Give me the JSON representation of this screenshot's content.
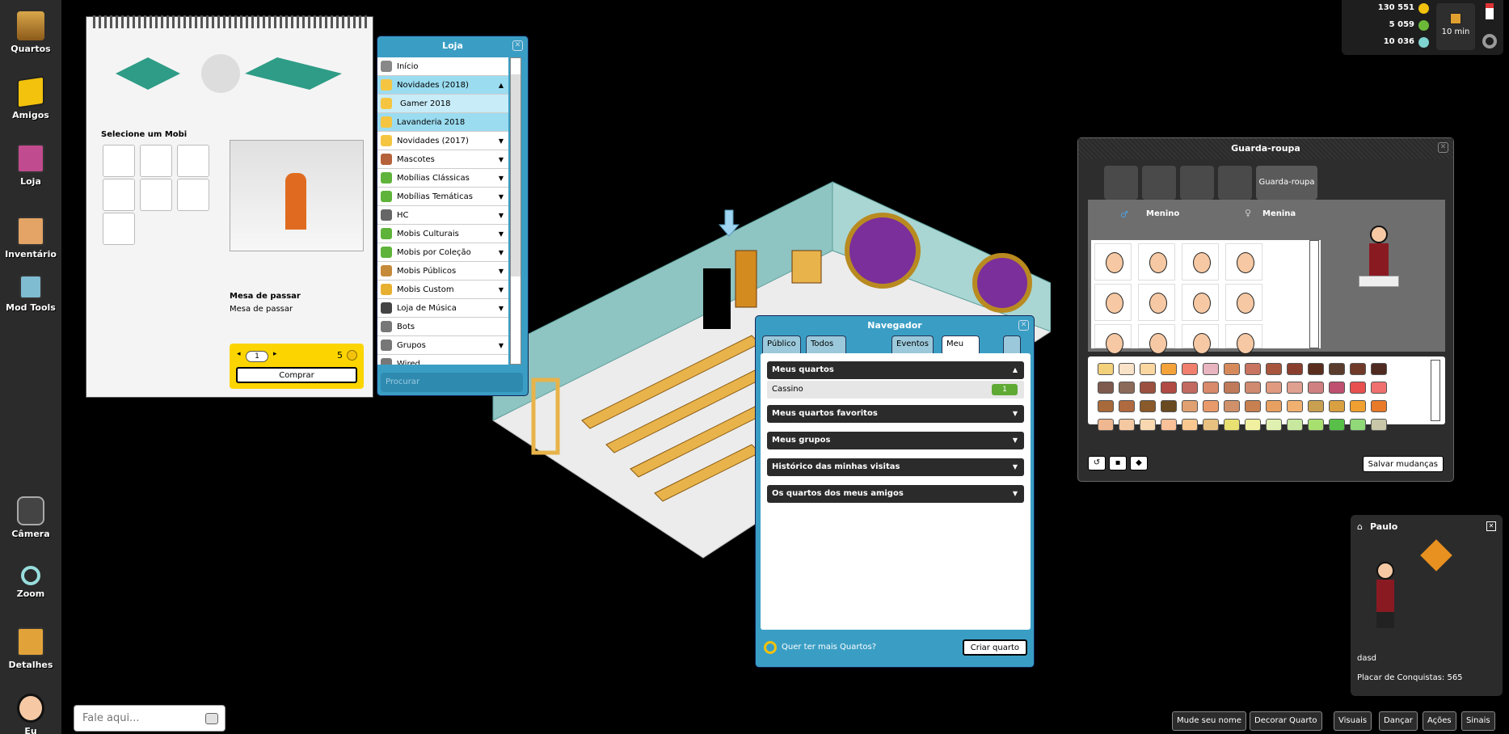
{
  "sidebar": {
    "items": [
      {
        "label": "Quartos",
        "icon": "hotel-icon"
      },
      {
        "label": "Amigos",
        "icon": "friends-icon"
      },
      {
        "label": "Loja",
        "icon": "catalog-icon"
      },
      {
        "label": "Inventário",
        "icon": "inventory-icon"
      },
      {
        "label": "Mod Tools",
        "icon": "mod-tools-icon"
      },
      {
        "label": "Câmera",
        "icon": "camera-icon"
      },
      {
        "label": "Zoom",
        "icon": "zoom-icon"
      },
      {
        "label": "Detalhes",
        "icon": "details-icon"
      },
      {
        "label": "Eu",
        "icon": "avatar-icon"
      }
    ]
  },
  "chat": {
    "placeholder": "Fale aqui..."
  },
  "currency": {
    "credits": "130 551",
    "duckets": "5 059",
    "diamonds": "10 036",
    "timer": "10 min",
    "colors": {
      "credits": "#f2c20c",
      "duckets": "#6cb93a",
      "diamonds": "#7fd3d0"
    }
  },
  "builder": {
    "select_label": "Selecione um Mobi",
    "mobi_name": "Mesa de passar",
    "mobi_desc": "Mesa de passar",
    "quantity": "1",
    "price": "5",
    "buy_label": "Comprar"
  },
  "loja": {
    "title": "Loja",
    "items": [
      {
        "label": "Início",
        "arrow": "",
        "state": "",
        "color": "#888"
      },
      {
        "label": "Novidades (2018)",
        "arrow": "▲",
        "state": "sel",
        "color": "#f5c542"
      },
      {
        "label": "Gamer 2018",
        "arrow": "",
        "state": "sub",
        "color": "#f5c542"
      },
      {
        "label": "Lavanderia 2018",
        "arrow": "",
        "state": "sel",
        "color": "#f5c542"
      },
      {
        "label": "Novidades (2017)",
        "arrow": "▼",
        "state": "",
        "color": "#f5c542"
      },
      {
        "label": "Mascotes",
        "arrow": "▼",
        "state": "",
        "color": "#b5623a"
      },
      {
        "label": "Mobílias Clássicas",
        "arrow": "▼",
        "state": "",
        "color": "#5fb33a"
      },
      {
        "label": "Mobílias Temáticas",
        "arrow": "▼",
        "state": "",
        "color": "#5fb33a"
      },
      {
        "label": "HC",
        "arrow": "▼",
        "state": "",
        "color": "#666"
      },
      {
        "label": "Mobis Culturais",
        "arrow": "▼",
        "state": "",
        "color": "#5fb33a"
      },
      {
        "label": "Mobis por Coleção",
        "arrow": "▼",
        "state": "",
        "color": "#5fb33a"
      },
      {
        "label": "Mobis Públicos",
        "arrow": "▼",
        "state": "",
        "color": "#c58a3a"
      },
      {
        "label": "Mobis Custom",
        "arrow": "▼",
        "state": "",
        "color": "#e8b030"
      },
      {
        "label": "Loja de Música",
        "arrow": "▼",
        "state": "",
        "color": "#444"
      },
      {
        "label": "Bots",
        "arrow": "",
        "state": "",
        "color": "#777"
      },
      {
        "label": "Grupos",
        "arrow": "▼",
        "state": "",
        "color": "#777"
      },
      {
        "label": "Wired",
        "arrow": "",
        "state": "",
        "color": "#777"
      }
    ],
    "search_placeholder": "Procurar"
  },
  "navigator": {
    "title": "Navegador",
    "tabs": [
      "Público",
      "Todos os quartos",
      "Eventos",
      "Meu mundo"
    ],
    "sections": [
      {
        "label": "Meus quartos",
        "chev": "▲"
      },
      {
        "label": "Meus quartos favoritos",
        "chev": "▼"
      },
      {
        "label": "Meus grupos",
        "chev": "▼"
      },
      {
        "label": "Histórico das minhas visitas",
        "chev": "▼"
      },
      {
        "label": "Os quartos dos meus amigos",
        "chev": "▼"
      }
    ],
    "room": {
      "name": "Cassino",
      "users": "1"
    },
    "footer_text": "Quer ter mais Quartos?",
    "create_label": "Criar quarto"
  },
  "wardrobe": {
    "title": "Guarda-roupa",
    "active_tab": "Guarda-roupa",
    "male_label": "Menino",
    "female_label": "Menina",
    "save_label": "Salvar mudanças"
  },
  "profile": {
    "name": "Paulo",
    "motto": "dasd",
    "achievements": "Placar de Conquistas: 565"
  },
  "bottom": [
    "Mude seu nome",
    "Decorar Quarto",
    "Visuais",
    "Dançar",
    "Ações",
    "Sinais"
  ]
}
